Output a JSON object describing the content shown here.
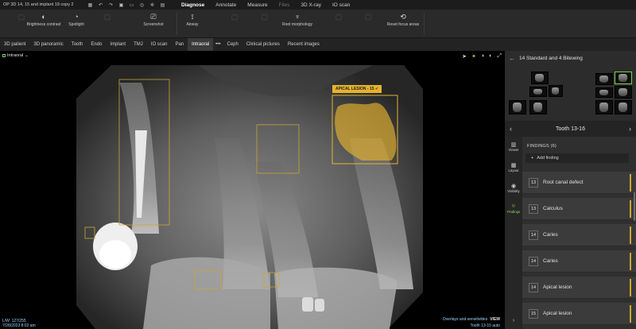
{
  "app": {
    "document_title": "OP 3D 14, 15 and implant 19 copy 2",
    "quick_actions": [
      "grid-icon",
      "undo-icon",
      "redo-icon",
      "save-icon",
      "print-icon",
      "help-icon",
      "settings-icon",
      "folder-icon"
    ]
  },
  "main_tabs": [
    {
      "label": "Diagnose",
      "active": true
    },
    {
      "label": "Annotate"
    },
    {
      "label": "Measure"
    },
    {
      "label": "Files",
      "dim": true
    },
    {
      "label": "3D X-ray"
    },
    {
      "label": "IO scan"
    }
  ],
  "toolbar": [
    {
      "label": "Brightness contrast",
      "icon": "half-circle-icon"
    },
    {
      "label": "Spotlight",
      "icon": "spotlight-icon"
    },
    {
      "label": "Screenshot",
      "icon": "screenshot-icon"
    },
    {
      "label": "Airway",
      "icon": "airway-icon"
    },
    {
      "label": "Root morphology",
      "icon": "tooth-icon"
    },
    {
      "label": "Reset focus areas",
      "icon": "reset-icon"
    }
  ],
  "module_tabs": [
    "3D patient",
    "3D panoramic",
    "Tooth",
    "Endo",
    "Implant",
    "TMJ",
    "IO scan",
    "Pan",
    "Intraoral",
    "Ceph",
    "Clinical pictures",
    "Recent images"
  ],
  "module_tabs_active": "Intraoral",
  "viewer": {
    "label": "Intraoral",
    "lesion_tag": "APICAL LESION - 15",
    "info_line1": "L/W: 127/255",
    "info_line2": "7/28/2023 8:02 am",
    "overlay_text": "Overlays and sensitivities",
    "overlay_link": "VIEW",
    "tooth_text": "Tooth 13-15 auto"
  },
  "right_panel": {
    "series_title": "14 Standard and 4 Bitewing",
    "tooth_nav_label": "Tooth 13-16",
    "side_items": [
      {
        "label": "Viewer",
        "icon": "viewer-icon"
      },
      {
        "label": "Layout",
        "icon": "layout-icon"
      },
      {
        "label": "Visibility",
        "icon": "eye-icon"
      },
      {
        "label": "Findings",
        "icon": "findings-icon",
        "active": true
      }
    ],
    "findings_title": "FINDINGS (6)",
    "add_placeholder": "Add finding",
    "findings": [
      {
        "tooth": "13",
        "label": "Root canal defect"
      },
      {
        "tooth": "13",
        "label": "Calculus"
      },
      {
        "tooth": "14",
        "label": "Caries"
      },
      {
        "tooth": "14",
        "label": "Caries"
      },
      {
        "tooth": "14",
        "label": "Apical lesion"
      },
      {
        "tooth": "15",
        "label": "Apical lesion"
      }
    ]
  },
  "colors": {
    "accent_green": "#7fd150",
    "lesion_yellow": "#e6b32e",
    "finding_bar": "#d1a52c"
  }
}
